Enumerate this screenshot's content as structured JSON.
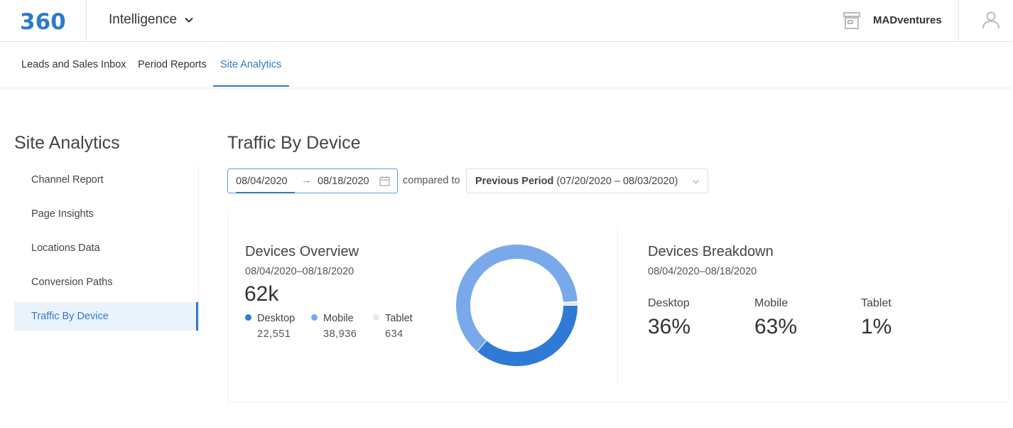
{
  "header": {
    "logo_text": "360",
    "app_name": "Intelligence",
    "account_name": "MADventures",
    "icons": {
      "store": "store-icon",
      "user": "user-icon",
      "chevron": "chevron-down-icon"
    }
  },
  "nav": {
    "tabs": [
      {
        "label": "Leads and Sales Inbox"
      },
      {
        "label": "Period Reports"
      },
      {
        "label": "Site Analytics",
        "active": true
      }
    ]
  },
  "sidebar": {
    "title": "Site Analytics",
    "items": [
      {
        "label": "Channel Report"
      },
      {
        "label": "Page Insights"
      },
      {
        "label": "Locations Data"
      },
      {
        "label": "Conversion Paths"
      },
      {
        "label": "Traffic By Device",
        "active": true
      }
    ]
  },
  "main": {
    "title": "Traffic By Device",
    "date_start": "08/04/2020",
    "date_arrow": "→",
    "date_end": "08/18/2020",
    "compared_to": "compared to",
    "compare_option": "Previous Period",
    "compare_range": "(07/20/2020 – 08/03/2020)"
  },
  "overview": {
    "title": "Devices Overview",
    "date_range": "08/04/2020–08/18/2020",
    "total": "62k",
    "legend": [
      {
        "label": "Desktop",
        "value": "22,551",
        "color": "#2f7ad6"
      },
      {
        "label": "Mobile",
        "value": "38,936",
        "color": "#79a9eb"
      },
      {
        "label": "Tablet",
        "value": "634",
        "color": "#e8e8e8"
      }
    ]
  },
  "chart_data": {
    "type": "pie",
    "categories": [
      "Desktop",
      "Mobile",
      "Tablet"
    ],
    "values": [
      22551,
      38936,
      634
    ],
    "colors": [
      "#2f7ad6",
      "#79a9eb",
      "#e8e8e8"
    ],
    "donut": true
  },
  "breakdown": {
    "title": "Devices Breakdown",
    "date_range": "08/04/2020–08/18/2020",
    "items": [
      {
        "label": "Desktop",
        "pct": "36%"
      },
      {
        "label": "Mobile",
        "pct": "63%"
      },
      {
        "label": "Tablet",
        "pct": "1%"
      }
    ]
  },
  "colors": {
    "accent": "#2f7ac9",
    "desktop": "#2f7ad6",
    "mobile": "#79a9eb",
    "tablet": "#e8e8e8"
  }
}
